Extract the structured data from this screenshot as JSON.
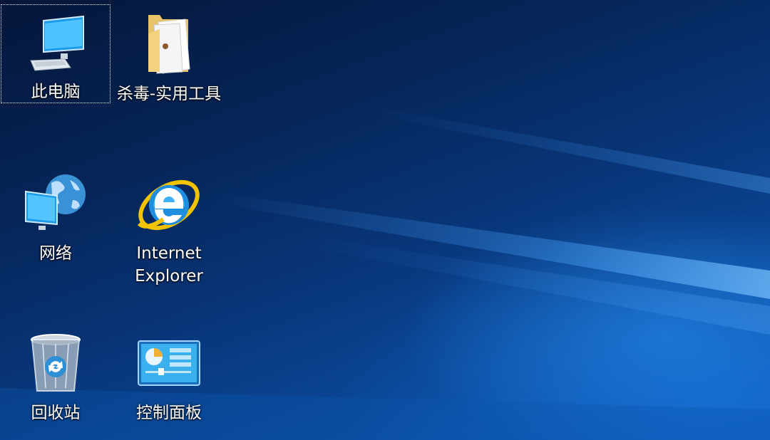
{
  "desktop": {
    "icons": [
      {
        "label": "此电脑",
        "icon": "computer-icon",
        "selected": true
      },
      {
        "label": "杀毒-实用工具",
        "icon": "folder-icon"
      },
      {
        "label": "网络",
        "icon": "network-icon"
      },
      {
        "label": "Internet Explorer",
        "icon": "internet-explorer-icon"
      },
      {
        "label": "回收站",
        "icon": "recycle-bin-icon"
      },
      {
        "label": "控制面板",
        "icon": "control-panel-icon"
      }
    ]
  },
  "colors": {
    "wallpaper_dark": "#04163a",
    "wallpaper_light": "#0d5cb8",
    "label_text": "#ffffff"
  }
}
